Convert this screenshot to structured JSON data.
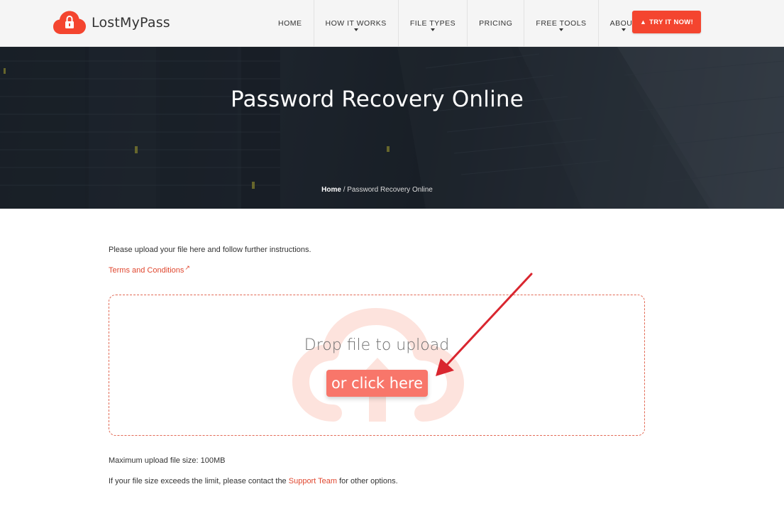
{
  "brand": {
    "name": "LostMyPass",
    "accent_color": "#f4452f",
    "logo_icon": "cloud-lock-icon"
  },
  "nav": {
    "items": [
      {
        "label": "HOME",
        "dropdown": false
      },
      {
        "label": "HOW IT WORKS",
        "dropdown": true
      },
      {
        "label": "FILE TYPES",
        "dropdown": true
      },
      {
        "label": "PRICING",
        "dropdown": false
      },
      {
        "label": "FREE TOOLS",
        "dropdown": true
      },
      {
        "label": "ABOUT",
        "dropdown": true
      }
    ],
    "cta_label": "TRY IT NOW!"
  },
  "hero": {
    "title": "Password Recovery Online",
    "breadcrumb": {
      "home": "Home",
      "separator": " / ",
      "current": "Password Recovery Online"
    }
  },
  "content": {
    "intro": "Please upload your file here and follow further instructions.",
    "terms_link": "Terms and Conditions",
    "dropzone": {
      "title": "Drop file to upload",
      "button": "or click here",
      "icon": "cloud-upload-icon"
    },
    "max_size": "Maximum upload file size: 100MB",
    "limit_prefix": "If your file size exceeds the limit, please contact the ",
    "limit_link": "Support Team",
    "limit_suffix": " for other options."
  },
  "annotation": {
    "color": "#d9262f",
    "icon": "red-arrow-annotation"
  }
}
